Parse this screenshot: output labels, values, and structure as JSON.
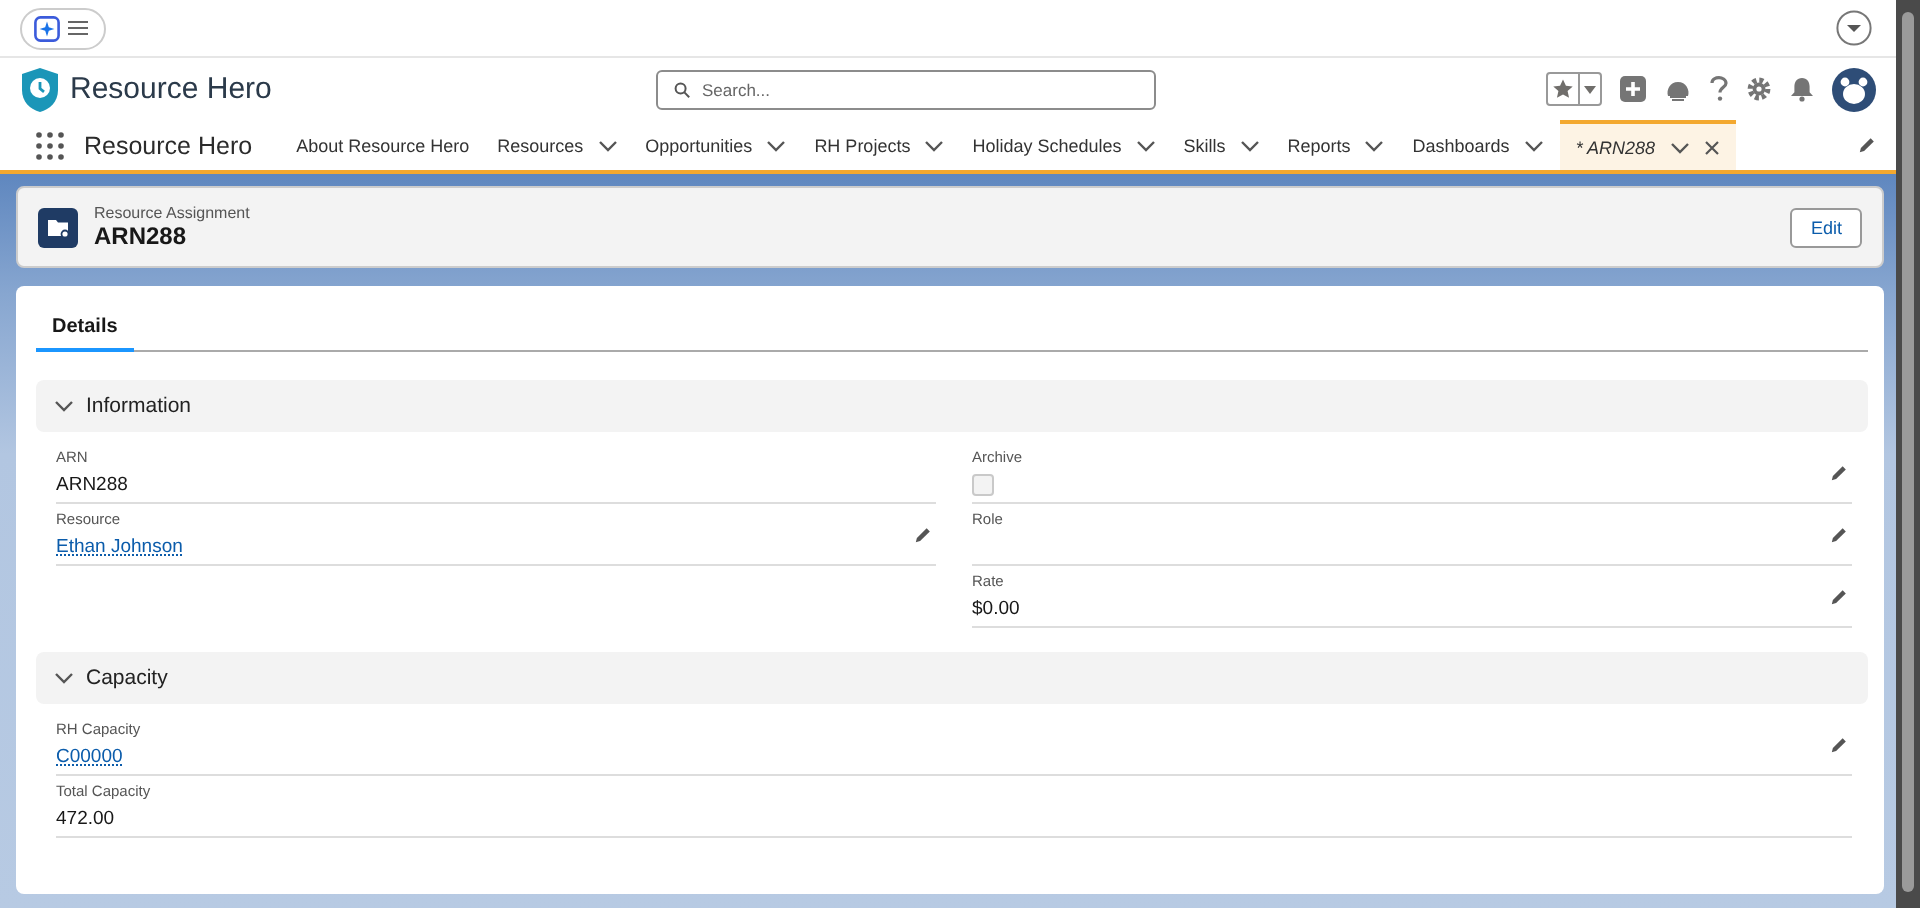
{
  "header": {
    "app_name": "Resource Hero",
    "search": {
      "placeholder": "Search..."
    }
  },
  "nav": {
    "app_name": "Resource Hero",
    "tabs": [
      {
        "label": "About Resource Hero",
        "has_menu": false,
        "selected": false,
        "closable": false
      },
      {
        "label": "Resources",
        "has_menu": true,
        "selected": false,
        "closable": false
      },
      {
        "label": "Opportunities",
        "has_menu": true,
        "selected": false,
        "closable": false
      },
      {
        "label": "RH Projects",
        "has_menu": true,
        "selected": false,
        "closable": false
      },
      {
        "label": "Holiday Schedules",
        "has_menu": true,
        "selected": false,
        "closable": false
      },
      {
        "label": "Skills",
        "has_menu": true,
        "selected": false,
        "closable": false
      },
      {
        "label": "Reports",
        "has_menu": true,
        "selected": false,
        "closable": false
      },
      {
        "label": "Dashboards",
        "has_menu": true,
        "selected": false,
        "closable": false
      },
      {
        "label": "* ARN288",
        "has_menu": true,
        "selected": true,
        "closable": true
      }
    ]
  },
  "record": {
    "object_type": "Resource Assignment",
    "title": "ARN288",
    "edit_button": "Edit"
  },
  "detail_tabs": [
    {
      "label": "Details",
      "selected": true
    }
  ],
  "sections": [
    {
      "title": "Information",
      "expanded": true,
      "columns": [
        [
          {
            "label": "ARN",
            "kind": "text",
            "value": "ARN288",
            "editable": false
          },
          {
            "label": "Resource",
            "kind": "link",
            "value": "Ethan Johnson",
            "editable": true
          }
        ],
        [
          {
            "label": "Archive",
            "kind": "checkbox",
            "checked": false,
            "editable": true
          },
          {
            "label": "Role",
            "kind": "text",
            "editable": true
          },
          {
            "label": "Rate",
            "kind": "text",
            "value": "$0.00",
            "editable": true
          }
        ]
      ]
    },
    {
      "title": "Capacity",
      "expanded": true,
      "columns": [
        [
          {
            "label": "RH Capacity",
            "kind": "link",
            "value": "C00000",
            "editable": true
          },
          {
            "label": "Total Capacity",
            "kind": "text",
            "value": "472.00",
            "editable": false
          }
        ]
      ]
    }
  ]
}
